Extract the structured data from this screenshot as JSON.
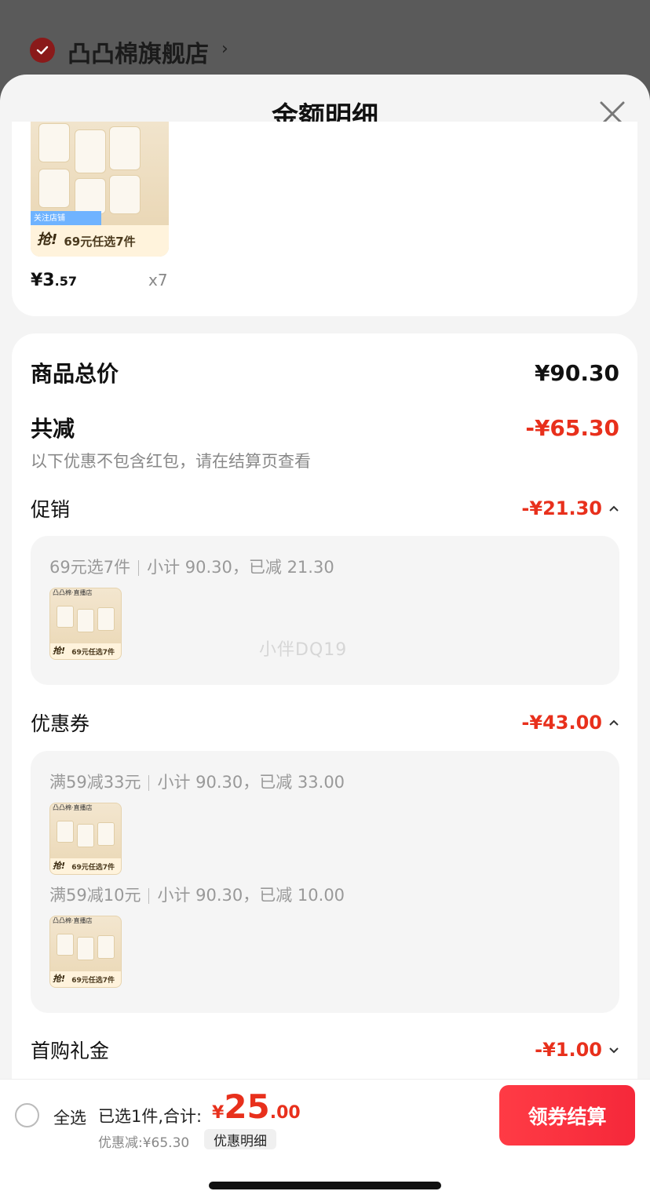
{
  "store": {
    "name": "凸凸棉旗舰店",
    "arrow": "›"
  },
  "sheet": {
    "title": "金额明细"
  },
  "product": {
    "price_int": "¥3",
    "price_dec": ".57",
    "qty": "x7",
    "image": {
      "follow": "关注店铺",
      "qiang": "抢!",
      "tag": "69元任选7件"
    }
  },
  "summary": {
    "total_label": "商品总价",
    "total_value": "¥90.30",
    "reduce_label": "共减",
    "reduce_value": "-¥65.30",
    "hint": "以下优惠不包含红包，请在结算页查看"
  },
  "promotion": {
    "label": "促销",
    "value": "-¥21.30",
    "rule": "69元选7件",
    "subtotal": "小计 90.30，已减 21.30"
  },
  "coupon": {
    "label": "优惠券",
    "value": "-¥43.00",
    "items": [
      {
        "rule": "满59减33元",
        "subtotal": "小计 90.30，已减 33.00"
      },
      {
        "rule": "满59减10元",
        "subtotal": "小计 90.30，已减 10.00"
      }
    ]
  },
  "first_gift": {
    "label": "首购礼金",
    "value": "-¥1.00"
  },
  "thumb": {
    "top": "凸凸棉·直播店",
    "qiang": "抢!",
    "tag": "69元任选7件"
  },
  "watermark": "小伴DQ19",
  "bottom": {
    "select_all": "全选",
    "selected_text": "已选1件,合计:",
    "currency": "¥",
    "total_int": "25",
    "total_dec": ".00",
    "discount": "优惠减:¥65.30",
    "detail_btn": "优惠明细",
    "checkout": "领券结算"
  },
  "colors": {
    "accent": "#e8301c",
    "checkout": "#f5283a"
  }
}
